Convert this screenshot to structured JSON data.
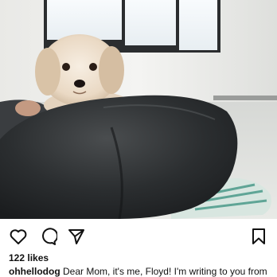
{
  "post": {
    "likes_text": "122 likes",
    "username": "ohhellodog",
    "caption": "Dear Mom, it's me, Floyd! I'm writing to you from"
  },
  "icons": {
    "like": "heart-icon",
    "comment": "comment-bubble-icon",
    "share": "paper-plane-icon",
    "save": "bookmark-icon"
  }
}
